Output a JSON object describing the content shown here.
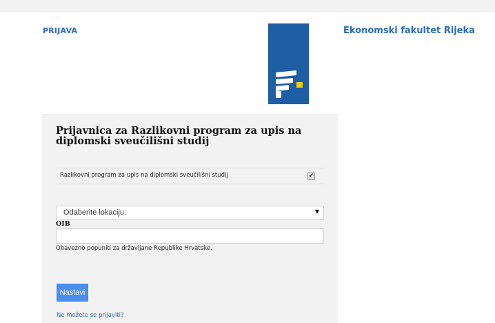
{
  "header": {
    "login_link": "PRIJAVA",
    "faculty_name": "Ekonomski fakultet Rijeka"
  },
  "logo": {
    "icon": "faculty-logo-icon",
    "background": "#1f5da4",
    "accent": "#f5d000"
  },
  "form": {
    "title": "Prijavnica za Razlikovni program za upis na diplomski sveučilišni studij",
    "program": {
      "label": "Razlikovni program za upis na diplomski sveučilišni studij",
      "checked": true,
      "check_mark": "✔"
    },
    "location": {
      "value": "Odaberite lokaciju:",
      "caret": "▼"
    },
    "oib": {
      "label": "OIB",
      "value": "",
      "help": "Obavezno popuniti za državljane Republike Hrvatske."
    },
    "continue_label": "Nastavi",
    "cant_login_link": "Ne možete se prijaviti?"
  },
  "colors": {
    "link": "#2a6bbf",
    "button": "#4a8ef0",
    "panel": "#f2f2f2"
  }
}
